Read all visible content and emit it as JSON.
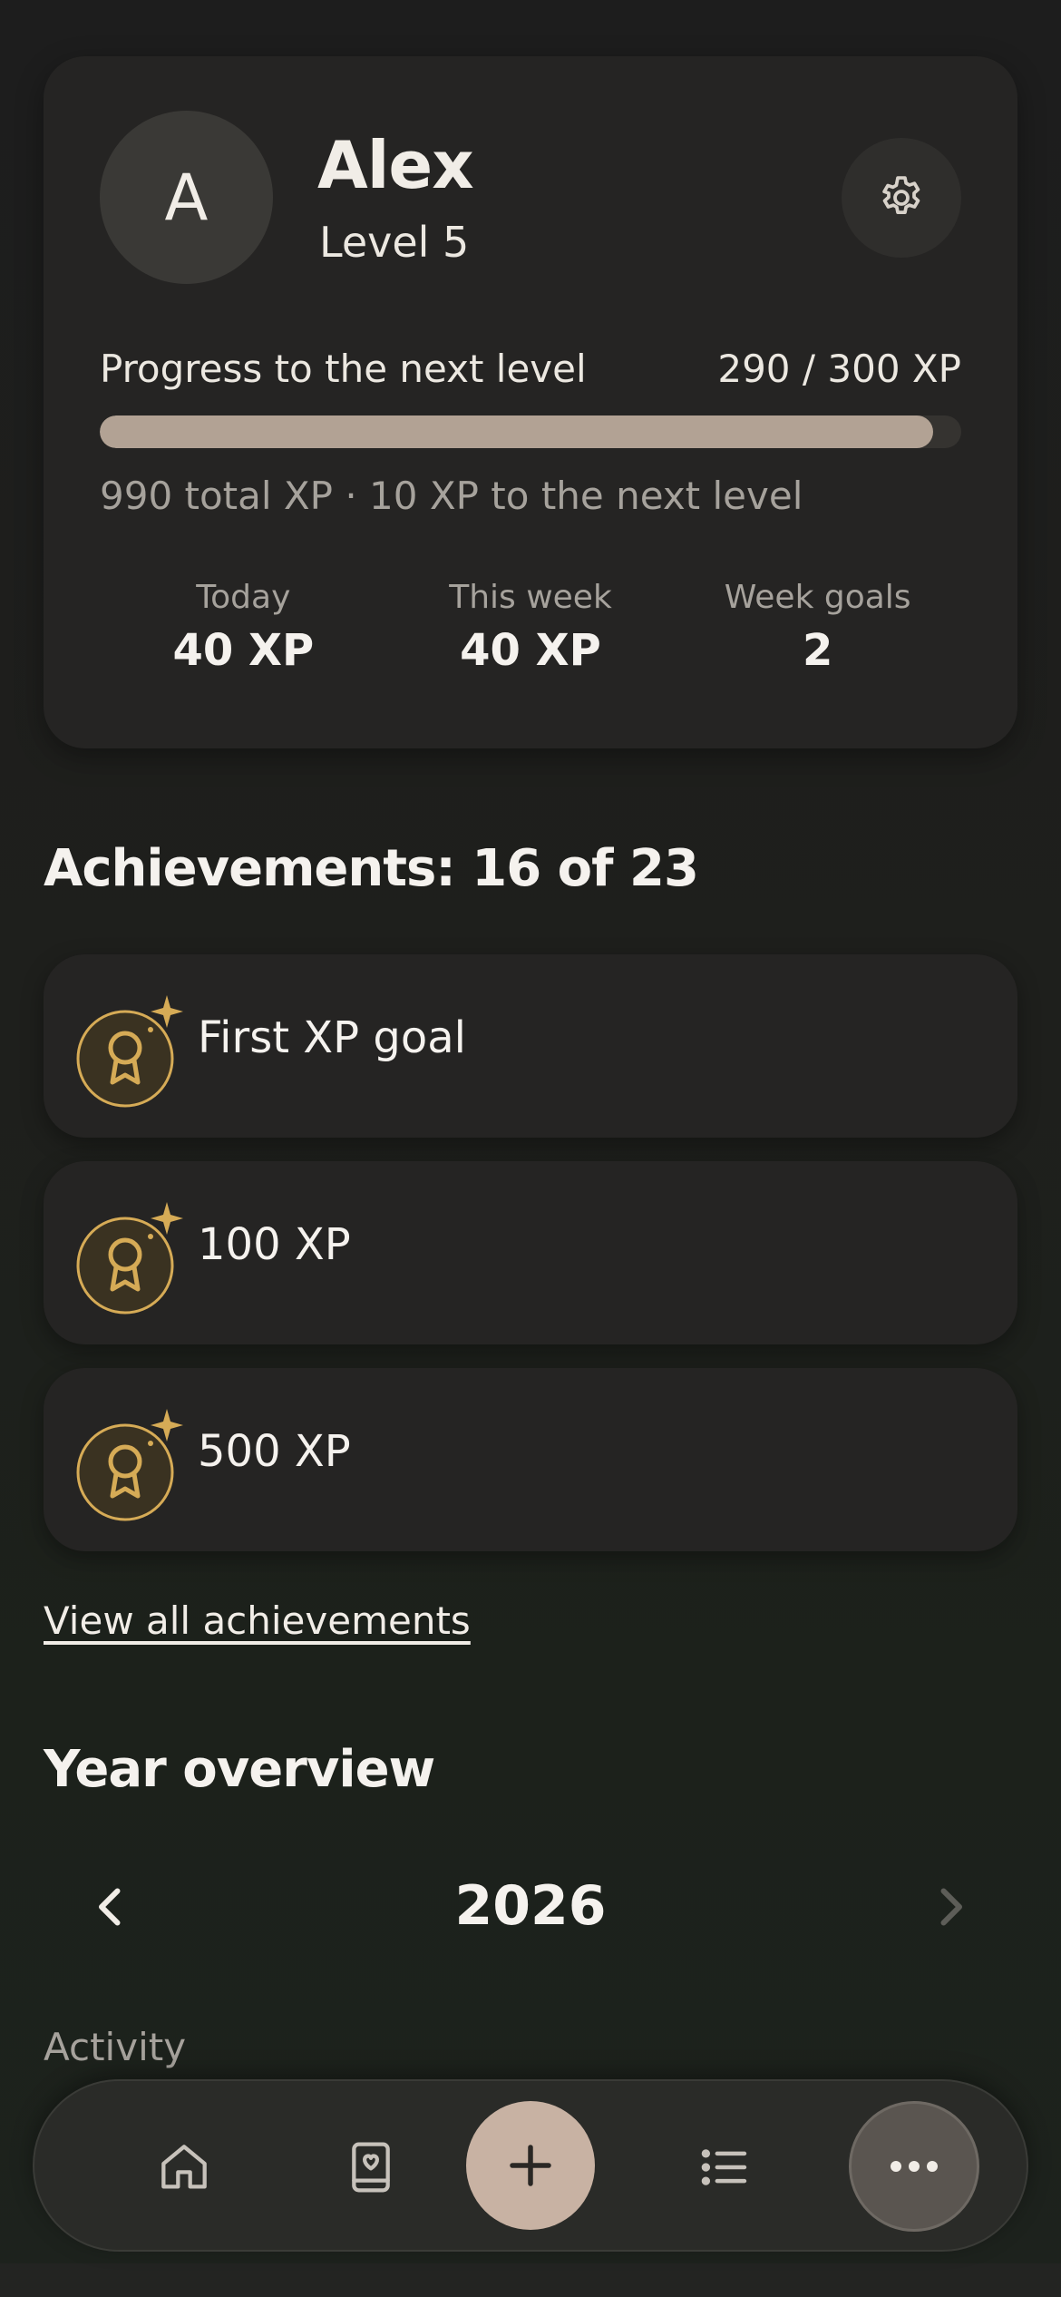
{
  "profile": {
    "avatar_initial": "A",
    "name": "Alex",
    "level": "Level 5",
    "progress_label": "Progress to the next level",
    "progress_value": "290 / 300 XP",
    "progress_fraction": 0.967,
    "total_xp_text": "990 total XP · 10 XP to the next level",
    "stats": [
      {
        "label": "Today",
        "value": "40 XP"
      },
      {
        "label": "This week",
        "value": "40 XP"
      },
      {
        "label": "Week goals",
        "value": "2"
      }
    ]
  },
  "achievements": {
    "title": "Achievements: 16 of 23",
    "items": [
      {
        "label": "First XP goal",
        "icon": "award-sparkle-icon"
      },
      {
        "label": "100 XP",
        "icon": "award-sparkle-icon"
      },
      {
        "label": "500 XP",
        "icon": "award-sparkle-icon"
      }
    ],
    "view_all": "View all achievements"
  },
  "year_overview": {
    "title": "Year overview",
    "year": "2026",
    "activity_label": "Activity"
  },
  "bottom_nav": {
    "items": [
      "home-icon",
      "journal-heart-icon",
      "add-icon",
      "list-icon",
      "more-icon"
    ]
  },
  "colors": {
    "accent_gold": "#d6ab56",
    "progress_fill": "#b2a294",
    "add_button": "#c8b2a3"
  }
}
